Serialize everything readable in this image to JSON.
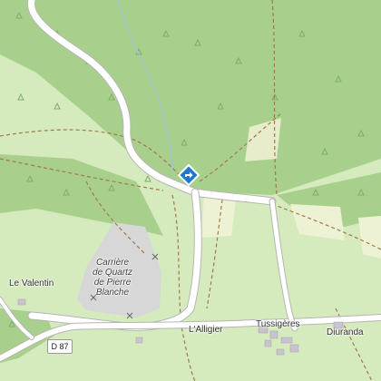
{
  "map": {
    "labels": {
      "quarry_line1": "Carrière",
      "quarry_line2": "de Quartz",
      "quarry_line3": "de Pierre",
      "quarry_line4": "Blanche",
      "le_valentin": "Le Valentin",
      "lalligier": "L'Alligier",
      "tussigeres": "Tussigères",
      "diuranda": "Diuranda",
      "road_shield": "D 87"
    },
    "colors": {
      "forest": "#a8d08c",
      "meadow": "#d6ebbd",
      "field": "#eef2d4",
      "quarry": "#d7d7d7",
      "road": "#ffffff",
      "track": "#a07a4a",
      "marker": "#1e78d2"
    },
    "marker_icon": "direction-diamond-icon"
  }
}
